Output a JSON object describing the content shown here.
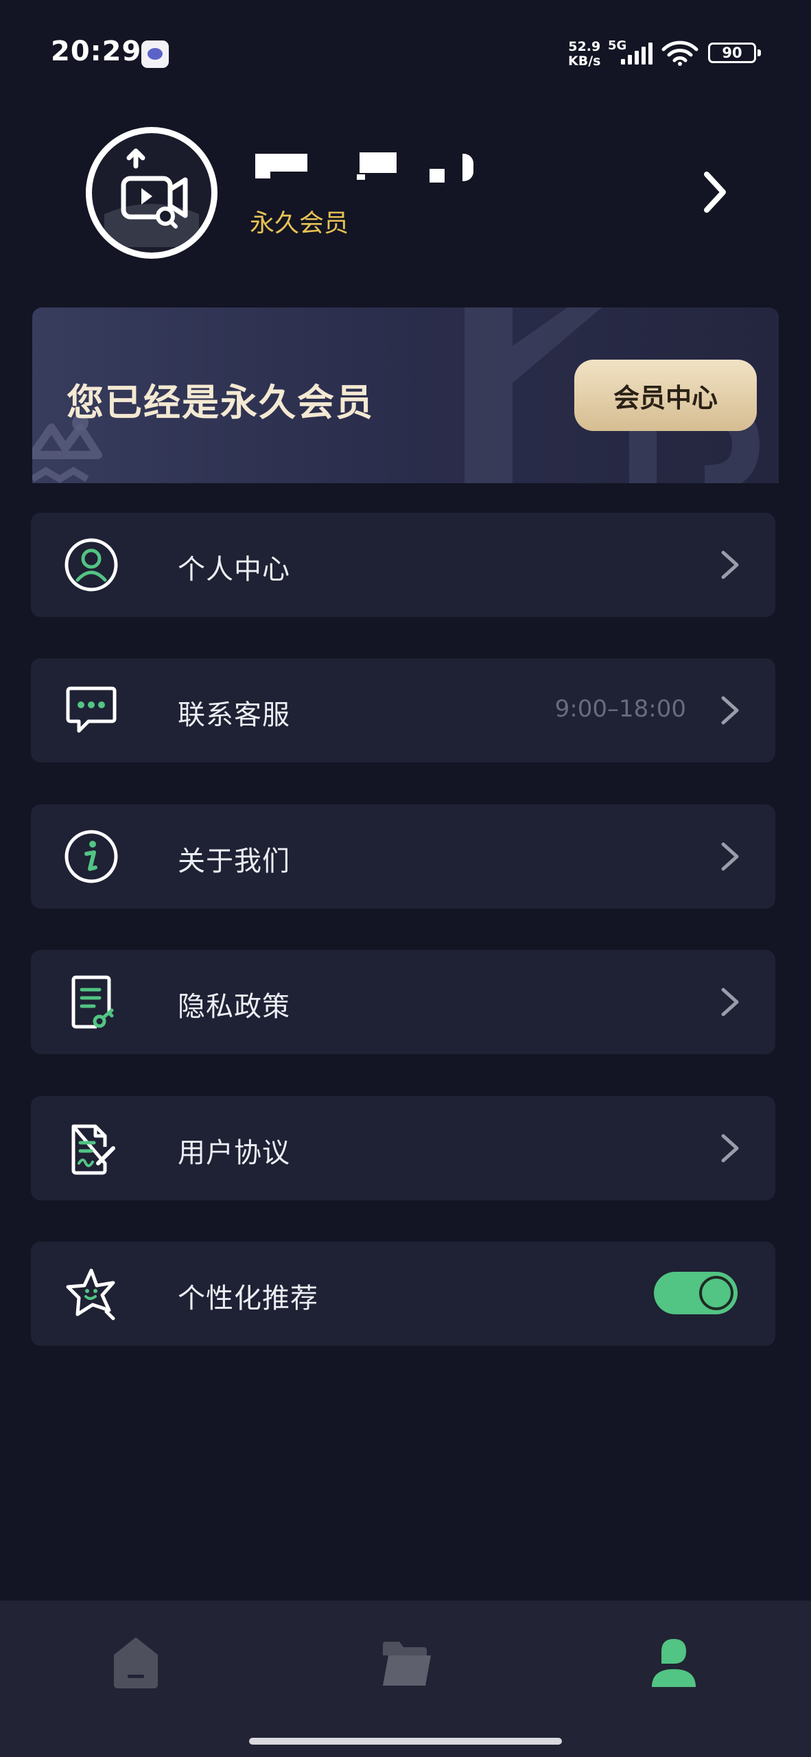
{
  "status_bar": {
    "time": "20:29",
    "net_speed_value": "52.9",
    "net_speed_unit": "KB/s",
    "network_type": "5G",
    "battery": "90"
  },
  "profile": {
    "member_label": "永久会员"
  },
  "vip_banner": {
    "text": "您已经是永久会员",
    "button_label": "会员中心"
  },
  "menu": [
    {
      "label": "个人中心",
      "icon": "user-circle-icon",
      "hint": ""
    },
    {
      "label": "联系客服",
      "icon": "chat-bubble-icon",
      "hint": "9:00–18:00"
    },
    {
      "label": "关于我们",
      "icon": "info-icon",
      "hint": ""
    },
    {
      "label": "隐私政策",
      "icon": "document-key-icon",
      "hint": ""
    },
    {
      "label": "用户协议",
      "icon": "document-signature-icon",
      "hint": ""
    },
    {
      "label": "个性化推荐",
      "icon": "star-face-icon",
      "toggle_on": true
    }
  ],
  "tab_bar": {
    "tabs": [
      {
        "icon": "home-icon",
        "active": false
      },
      {
        "icon": "folder-icon",
        "active": false
      },
      {
        "icon": "profile-icon",
        "active": true
      }
    ]
  },
  "colors": {
    "background": "#131524",
    "card": "#1f2134",
    "accent_green": "#52c483",
    "member_gold": "#e8c255",
    "vip_button": "#e6d2ad"
  }
}
